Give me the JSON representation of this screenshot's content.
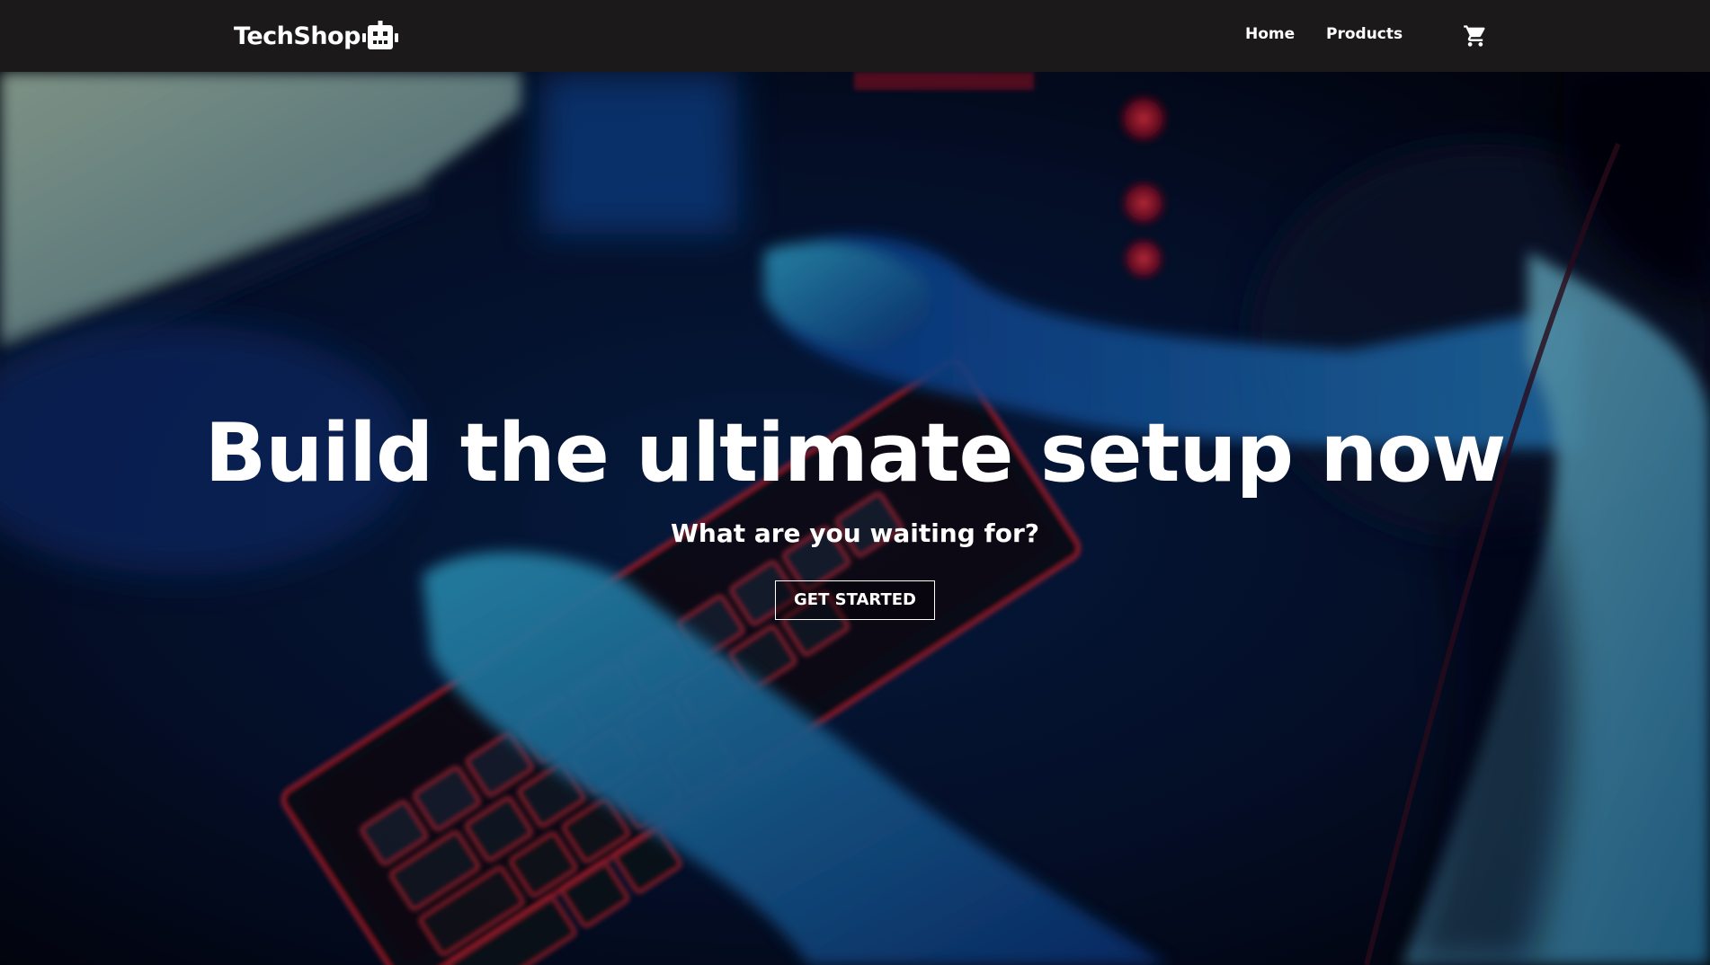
{
  "navbar": {
    "brand": "TechShop",
    "brand_icon": "robot-icon",
    "links": [
      {
        "label": "Home"
      },
      {
        "label": "Products"
      }
    ],
    "cart_icon": "cart-icon"
  },
  "hero": {
    "title": "Build the ultimate setup now",
    "subtitle": "What are you waiting for?",
    "cta_label": "GET STARTED",
    "background": "gaming-keyboard-photo"
  },
  "colors": {
    "navbar_bg": "#1b1919",
    "text": "#ffffff",
    "hero_accent_red": "#ff2a3a",
    "hero_accent_blue": "#1e6fd6"
  }
}
